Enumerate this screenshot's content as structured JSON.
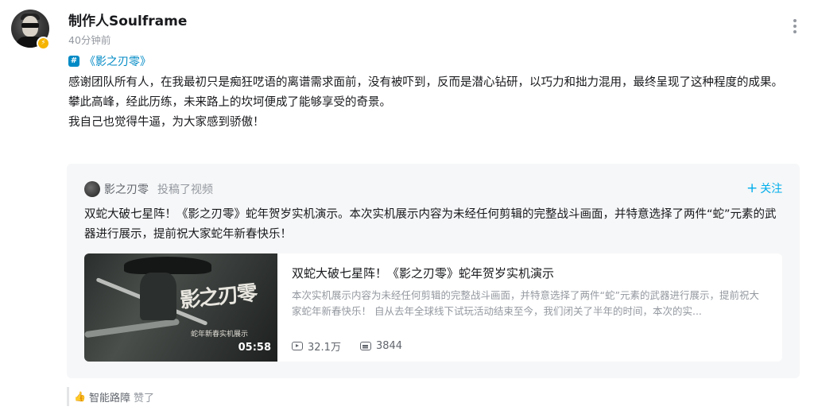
{
  "author": {
    "name": "制作人Soulframe",
    "time": "40分钟前",
    "avatar_icon": "user-avatar",
    "badge_icon": "verified-badge-icon"
  },
  "topic": {
    "icon": "#",
    "label": "《影之刃零》"
  },
  "post_text": [
    "感谢团队所有人，在我最初只是痴狂呓语的离谱需求面前，没有被吓到，反而是潜心钻研，以巧力和拙力混用，最终呈现了这种程度的成果。",
    "攀此高峰，经此历练，未来路上的坎坷便成了能够享受的奇景。",
    "我自己也觉得牛逼，为大家感到骄傲！"
  ],
  "repost": {
    "orig_name": "影之刃零",
    "orig_action": "投稿了视频",
    "follow_label": "关注",
    "text": "双蛇大破七星阵！《影之刃零》蛇年贺岁实机演示。本次实机展示内容为未经任何剪辑的完整战斗画面，并特意选择了两件“蛇”元素的武器进行展示，提前祝大家蛇年新春快乐！",
    "video": {
      "thumb_title": "影之刃零",
      "thumb_subtitle": "蛇年新春实机展示",
      "duration": "05:58",
      "title": "双蛇大破七星阵！《影之刃零》蛇年贺岁实机演示",
      "desc": "本次实机展示内容为未经任何剪辑的完整战斗画面，并特意选择了两件“蛇”元素的武器进行展示，提前祝大家蛇年新春快乐！ 自从去年全球线下试玩活动结束至今，我们闭关了半年的时间，本次的实...",
      "views": "32.1万",
      "danmaku": "3844"
    }
  },
  "likes": {
    "liker": "智能路障",
    "text": "赞了"
  }
}
